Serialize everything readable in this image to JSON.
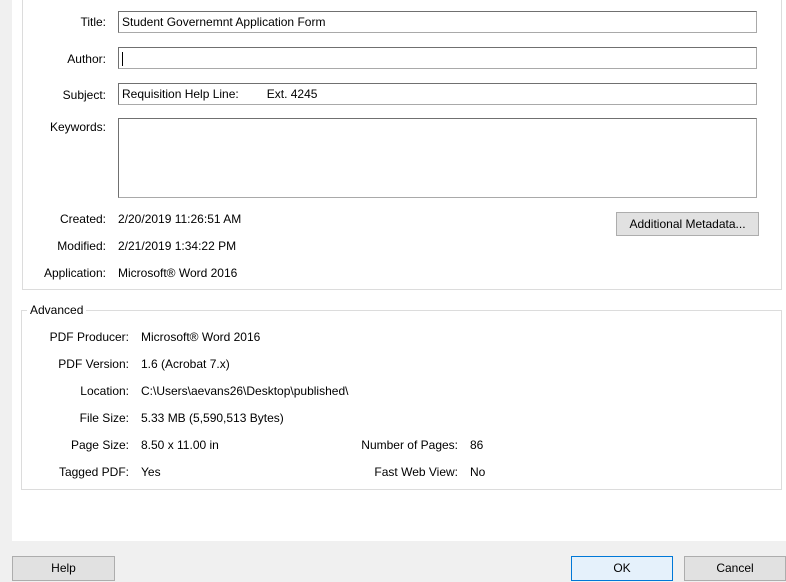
{
  "description": {
    "title_label": "Title:",
    "title_value": "Student Governemnt Application Form",
    "author_label": "Author:",
    "author_value": "",
    "subject_label": "Subject:",
    "subject_value": "Requisition Help Line:",
    "subject_ext": "Ext. 4245",
    "keywords_label": "Keywords:",
    "keywords_value": "",
    "created_label": "Created:",
    "created_value": "2/20/2019 11:26:51 AM",
    "modified_label": "Modified:",
    "modified_value": "2/21/2019 1:34:22 PM",
    "application_label": "Application:",
    "application_value": "Microsoft® Word 2016",
    "additional_metadata_button": "Additional Metadata..."
  },
  "advanced": {
    "legend": "Advanced",
    "pdf_producer_label": "PDF Producer:",
    "pdf_producer_value": "Microsoft® Word 2016",
    "pdf_version_label": "PDF Version:",
    "pdf_version_value": "1.6 (Acrobat 7.x)",
    "location_label": "Location:",
    "location_value": "C:\\Users\\aevans26\\Desktop\\published\\",
    "file_size_label": "File Size:",
    "file_size_value": "5.33 MB (5,590,513 Bytes)",
    "page_size_label": "Page Size:",
    "page_size_value": "8.50 x 11.00 in",
    "num_pages_label": "Number of Pages:",
    "num_pages_value": "86",
    "tagged_pdf_label": "Tagged PDF:",
    "tagged_pdf_value": "Yes",
    "fast_web_view_label": "Fast Web View:",
    "fast_web_view_value": "No"
  },
  "footer": {
    "help_button": "Help",
    "ok_button": "OK",
    "cancel_button": "Cancel"
  }
}
